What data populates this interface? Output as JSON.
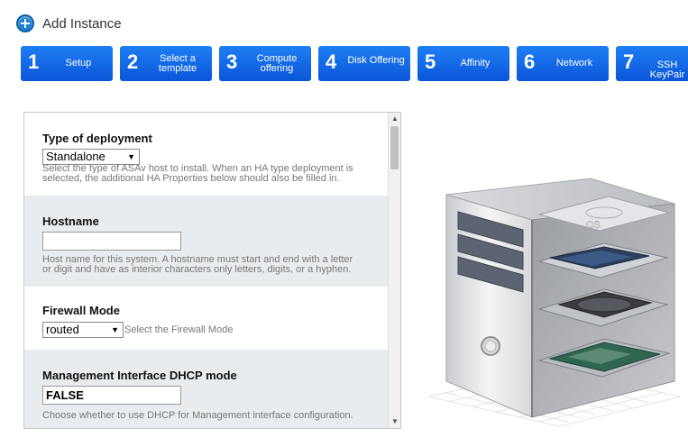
{
  "header": {
    "title": "Add Instance",
    "icon": "add-icon",
    "icon_color": "#1a7fd4"
  },
  "steps": [
    {
      "number": "1",
      "label": "Setup"
    },
    {
      "number": "2",
      "label": "Select a template"
    },
    {
      "number": "3",
      "label": "Compute offering"
    },
    {
      "number": "4",
      "label": "Disk Offering"
    },
    {
      "number": "5",
      "label": "Affinity"
    },
    {
      "number": "6",
      "label": "Network"
    },
    {
      "number": "7",
      "label": "SSH KeyPair"
    }
  ],
  "form": {
    "deployment": {
      "label": "Type of deployment",
      "value": "Standalone",
      "description": "Select the type of ASAv host to install. When an HA type deployment is selected, the additional HA Properties below should also be filled in."
    },
    "hostname": {
      "label": "Hostname",
      "value": "",
      "description": "Host name for this system. A hostname must start and end with a letter or digit and have as interior characters only letters, digits, or a hyphen."
    },
    "firewall": {
      "label": "Firewall Mode",
      "value": "routed",
      "hint": "Select the Firewall Mode"
    },
    "mgmt_dhcp": {
      "label": "Management Interface DHCP mode",
      "value": "FALSE",
      "description": "Choose whether to use DHCP for Management interface configuration."
    }
  },
  "illustration": {
    "os_label": "OS"
  },
  "colors": {
    "step_blue": "#0a55d8",
    "alt_row": "#e8ecef"
  }
}
